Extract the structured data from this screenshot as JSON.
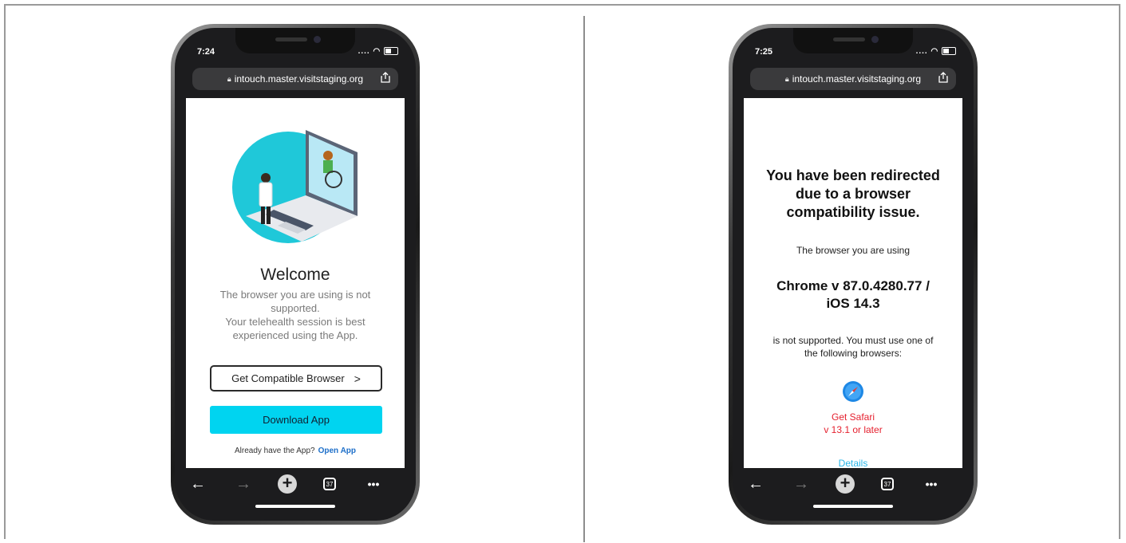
{
  "colors": {
    "accent_cyan": "#00d4f0",
    "safari_red": "#e5212f",
    "link_blue": "#1d6fc9",
    "details_cyan": "#29b6e8"
  },
  "left_phone": {
    "time": "7:24",
    "status_icons": "....",
    "url": "intouch.master.visitstaging.org",
    "welcome": "Welcome",
    "message_lines": [
      "The browser you are using is not",
      "supported.",
      "Your telehealth session is best",
      "experienced using the App."
    ],
    "compat_button": "Get Compatible Browser",
    "compat_chevron": ">",
    "download_button": "Download App",
    "already_text": "Already have the App?",
    "open_app": "Open App",
    "toolbar": {
      "back": "←",
      "forward": "→",
      "new_tab": "+",
      "tab_count": "37",
      "more": "•••"
    },
    "illustration_icon": "doctor-telehealth-laptop-icon"
  },
  "right_phone": {
    "time": "7:25",
    "status_icons": "....",
    "url": "intouch.master.visitstaging.org",
    "title_lines": [
      "You have been redirected",
      "due to a browser",
      "compatibility issue."
    ],
    "using_text": "The browser you are using",
    "browser_lines": [
      "Chrome v 87.0.4280.77 /",
      "iOS 14.3"
    ],
    "not_supported_lines": [
      "is not supported. You must use one of",
      "the following browsers:"
    ],
    "safari_icon": "safari-compass-icon",
    "get_safari_lines": [
      "Get Safari",
      "v 13.1 or later"
    ],
    "details": "Details",
    "toolbar": {
      "back": "←",
      "forward": "→",
      "new_tab": "+",
      "tab_count": "37",
      "more": "•••"
    }
  }
}
